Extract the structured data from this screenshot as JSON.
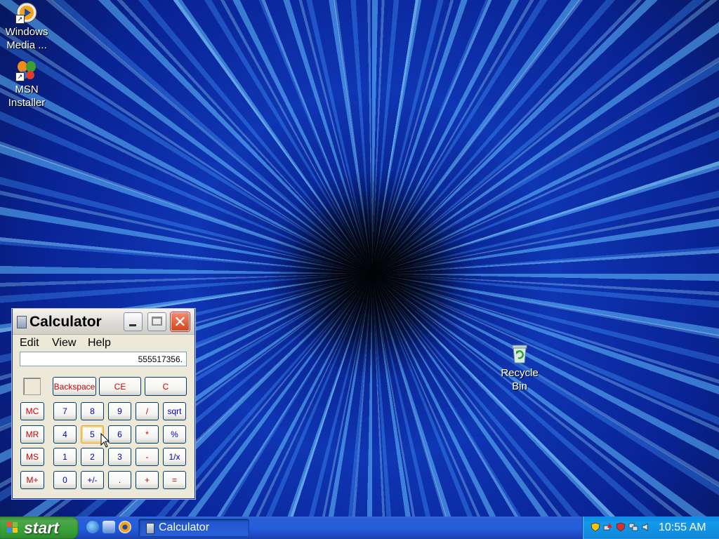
{
  "desktop": {
    "icons": [
      {
        "label_line1": "Windows",
        "label_line2": "Media ...",
        "icon": "windows-media-player-icon"
      },
      {
        "label_line1": "MSN",
        "label_line2": "Installer",
        "icon": "msn-butterfly-icon"
      },
      {
        "label_line1": "Recycle",
        "label_line2": "Bin",
        "icon": "recycle-bin-icon"
      }
    ]
  },
  "calculator": {
    "title": "Calculator",
    "menu": [
      "Edit",
      "View",
      "Help"
    ],
    "display": "555517356.",
    "buttons": {
      "backspace": "Backspace",
      "ce": "CE",
      "c": "C",
      "mc": "MC",
      "mr": "MR",
      "ms": "MS",
      "mplus": "M+",
      "n7": "7",
      "n8": "8",
      "n9": "9",
      "div": "/",
      "sqrt": "sqrt",
      "n4": "4",
      "n5": "5",
      "n6": "6",
      "mul": "*",
      "pct": "%",
      "n1": "1",
      "n2": "2",
      "n3": "3",
      "sub": "-",
      "inv": "1/x",
      "n0": "0",
      "sign": "+/-",
      "dot": ".",
      "add": "+",
      "eq": "="
    }
  },
  "taskbar": {
    "start_label": "start",
    "tasks": [
      {
        "label": "Calculator",
        "icon": "calculator-icon"
      }
    ],
    "quick_launch": [
      "internet-explorer-icon",
      "show-desktop-ie-icon",
      "media-player-icon"
    ],
    "clock": "10:55 AM"
  },
  "colors": {
    "taskbar_blue": "#245edb",
    "start_green": "#37a137",
    "tray_blue": "#139ae9",
    "calc_body": "#ece9d8",
    "calc_digit_text": "#0000c0",
    "calc_op_text": "#d00000"
  }
}
